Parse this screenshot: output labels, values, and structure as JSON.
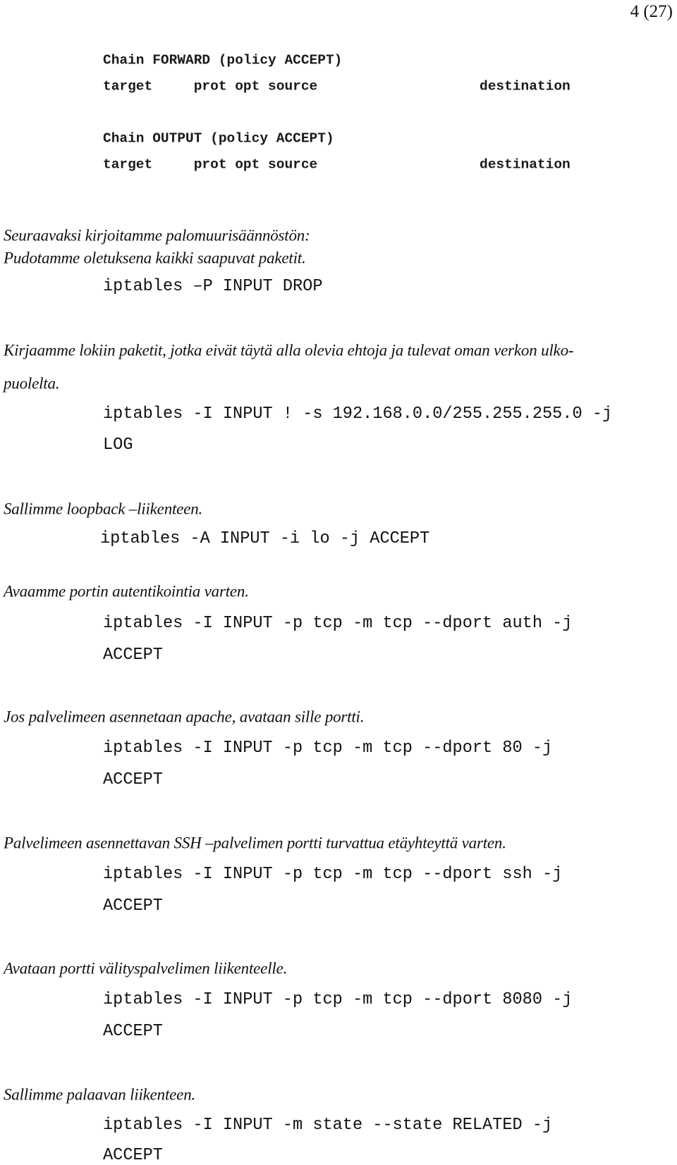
{
  "page": {
    "page_number": "4 (27)"
  },
  "chains": [
    {
      "header": "Chain FORWARD (policy ACCEPT)",
      "columns_left": "target     prot opt source",
      "columns_right": "destination"
    },
    {
      "header": "Chain OUTPUT (policy ACCEPT)",
      "columns_left": "target     prot opt source",
      "columns_right": "destination"
    }
  ],
  "intro": {
    "line1": "Seuraavaksi kirjoitamme palomuurisäännöstön:",
    "line2": "Pudotamme oletuksena kaikki saapuvat paketit."
  },
  "sections": [
    {
      "description": [
        "Pudotamme oletuksena kaikki saapuvat paketit."
      ],
      "command": [
        "iptables –P INPUT DROP"
      ]
    },
    {
      "description": [
        "Kirjaamme lokiin paketit, jotka eivät täytä alla olevia ehtoja ja tulevat oman verkon ulko-",
        "puolelta."
      ],
      "command": [
        "iptables -I INPUT ! -s 192.168.0.0/255.255.255.0 -j",
        "LOG"
      ]
    },
    {
      "description": [
        "Sallimme loopback –liikenteen."
      ],
      "command": [
        "iptables -A INPUT -i lo -j ACCEPT"
      ]
    },
    {
      "description": [
        "Avaamme portin autentikointia varten."
      ],
      "command": [
        "iptables -I INPUT -p tcp -m tcp --dport auth -j",
        "ACCEPT"
      ]
    },
    {
      "description": [
        "Jos palvelimeen asennetaan apache, avataan sille portti."
      ],
      "command": [
        "iptables -I INPUT -p tcp -m tcp --dport 80 -j",
        "ACCEPT"
      ]
    },
    {
      "description": [
        "Palvelimeen asennettavan SSH –palvelimen portti turvattua etäyhteyttä varten."
      ],
      "command": [
        "iptables -I INPUT -p tcp -m tcp --dport ssh -j",
        "ACCEPT"
      ]
    },
    {
      "description": [
        "Avataan portti välityspalvelimen liikenteelle."
      ],
      "command": [
        "iptables -I INPUT -p tcp -m tcp --dport 8080 -j",
        "ACCEPT"
      ]
    },
    {
      "description": [
        "Sallimme palaavan liikenteen."
      ],
      "command": [
        "iptables -I INPUT -m state --state RELATED -j",
        "ACCEPT"
      ]
    }
  ]
}
